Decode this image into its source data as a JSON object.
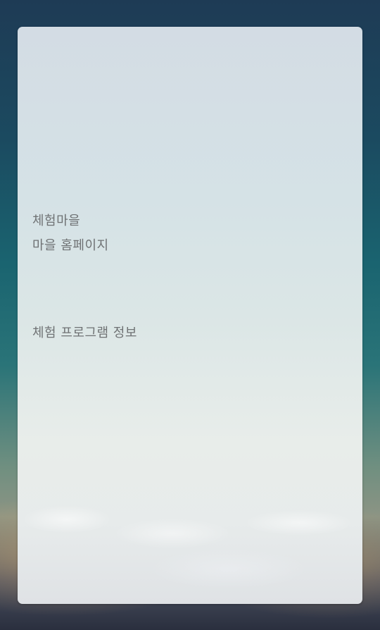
{
  "card": {
    "items": [
      {
        "label": "체험마을"
      },
      {
        "label": "마을 홈페이지"
      },
      {
        "label": "체험 프로그램 정보"
      }
    ]
  }
}
